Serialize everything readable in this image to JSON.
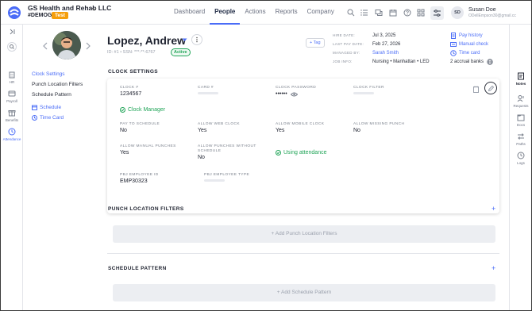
{
  "org": {
    "name": "GS Health and Rehab LLC",
    "code": "#DEMOGS",
    "badge": "Test"
  },
  "nav": {
    "items": [
      "Dashboard",
      "People",
      "Actions",
      "Reports",
      "Company"
    ],
    "active": "People"
  },
  "user": {
    "initials": "SD",
    "name": "Susan Doe",
    "email": "ODellEmpson30@gmail.cc"
  },
  "left_rail": [
    {
      "label": "HR",
      "icon": "building-icon"
    },
    {
      "label": "Payroll",
      "icon": "payroll-icon"
    },
    {
      "label": "Benefits",
      "icon": "gift-icon"
    },
    {
      "label": "Attendance",
      "icon": "clock-icon"
    }
  ],
  "right_rail": [
    {
      "label": "Notes",
      "icon": "notes-icon"
    },
    {
      "label": "Requests",
      "icon": "requests-icon"
    },
    {
      "label": "Docs",
      "icon": "docs-icon"
    },
    {
      "label": "Paths",
      "icon": "paths-icon"
    },
    {
      "label": "Logs",
      "icon": "logs-icon"
    }
  ],
  "employee": {
    "name": "Lopez, Andrew",
    "ids": "ID: #1 • SSN: ***-**-6767",
    "status": "Active",
    "tag_label": "+ Tag"
  },
  "meta": [
    {
      "label": "HIRE DATE:",
      "value": "Jul 3, 2025"
    },
    {
      "label": "LAST PAY DATE:",
      "value": "Feb 27, 2026"
    },
    {
      "label": "MANAGED BY:",
      "value": "Sarah Smith"
    },
    {
      "label": "JOB INFO:",
      "value": "Nursing • Manhattan • LED"
    }
  ],
  "quick_links": [
    "Pay history",
    "Manual check",
    "Time card",
    "2 accrual banks"
  ],
  "sidenav": {
    "items": [
      "Clock Settings",
      "Punch Location Filters",
      "Schedule Pattern"
    ],
    "links": [
      "Schedule",
      "Time Card"
    ]
  },
  "clock_settings": {
    "title": "CLOCK SETTINGS",
    "clock_num_label": "CLOCK #",
    "clock_num": "1234567",
    "card_num_label": "CARD #",
    "clock_password_label": "CLOCK PASSWORD",
    "clock_password": "••••••",
    "clock_filter_label": "CLOCK FILTER",
    "clock_manager": "Clock Manager",
    "pay_to_schedule_label": "PAY TO SCHEDULE",
    "pay_to_schedule": "No",
    "allow_web_label": "ALLOW WEB CLOCK",
    "allow_web": "Yes",
    "allow_mobile_label": "ALLOW MOBILE CLOCK",
    "allow_mobile": "Yes",
    "allow_missing_label": "ALLOW MISSING PUNCH",
    "allow_missing": "No",
    "allow_manual_label": "ALLOW MANUAL PUNCHES",
    "allow_manual": "Yes",
    "allow_without_label_1": "ALLOW PUNCHES WITHOUT",
    "allow_without_label_2": "SCHEDULE",
    "allow_without": "No",
    "using_attendance": "Using attendance",
    "pbj_id_label": "PBJ EMPLOYEE ID",
    "pbj_id": "EMP30323",
    "pbj_type_label": "PBJ EMPLOYEE TYPE"
  },
  "punch_filters": {
    "title": "PUNCH LOCATION FILTERS",
    "add_label": "+ Add Punch Location Filters"
  },
  "schedule_pattern": {
    "title": "SCHEDULE PATTERN",
    "add_label": "+ Add Schedule Pattern"
  },
  "colors": {
    "accent": "#4a6cf7",
    "success": "#22a559",
    "test_badge": "#f59e0b"
  }
}
